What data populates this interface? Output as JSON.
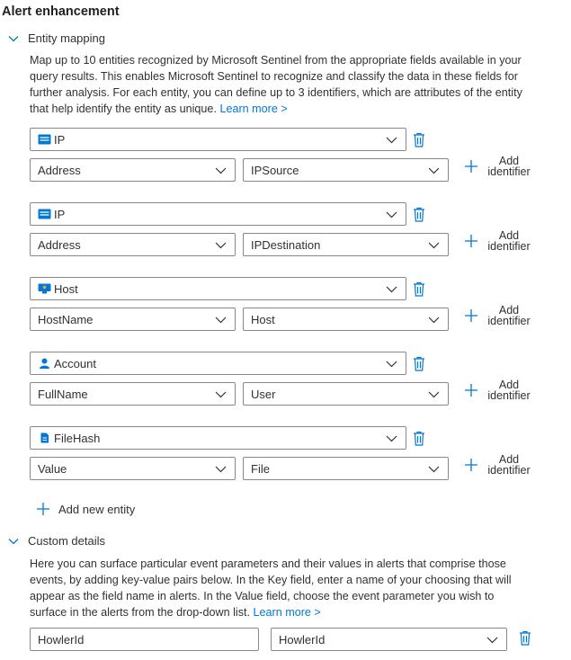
{
  "title": "Alert enhancement",
  "entity_mapping": {
    "header": "Entity mapping",
    "description": "Map up to 10 entities recognized by Microsoft Sentinel from the appropriate fields available in your query results. This enables Microsoft Sentinel to recognize and classify the data in these fields for further analysis. For each entity, you can define up to 3 identifiers, which are attributes of the entity that help identify the entity as unique.",
    "learn_more": "Learn more >",
    "add_identifier_line1": "Add",
    "add_identifier_line2": "identifier",
    "add_entity": "Add new entity",
    "entities": [
      {
        "type": "IP",
        "icon": "ip-icon",
        "identifier": "Address",
        "column": "IPSource"
      },
      {
        "type": "IP",
        "icon": "ip-icon",
        "identifier": "Address",
        "column": "IPDestination"
      },
      {
        "type": "Host",
        "icon": "host-icon",
        "identifier": "HostName",
        "column": "Host"
      },
      {
        "type": "Account",
        "icon": "account-icon",
        "identifier": "FullName",
        "column": "User"
      },
      {
        "type": "FileHash",
        "icon": "filehash-icon",
        "identifier": "Value",
        "column": "File"
      }
    ]
  },
  "custom_details": {
    "header": "Custom details",
    "description": "Here you can surface particular event parameters and their values in alerts that comprise those events, by adding key-value pairs below. In the Key field, enter a name of your choosing that will appear as the field name in alerts. In the Value field, choose the event parameter you wish to surface in the alerts from the drop-down list.",
    "learn_more": "Learn more >",
    "key_value": "HowlerId",
    "value_value": "HowlerId"
  },
  "colors": {
    "accent": "#0078d4",
    "border": "#8a8886",
    "text": "#323130"
  }
}
